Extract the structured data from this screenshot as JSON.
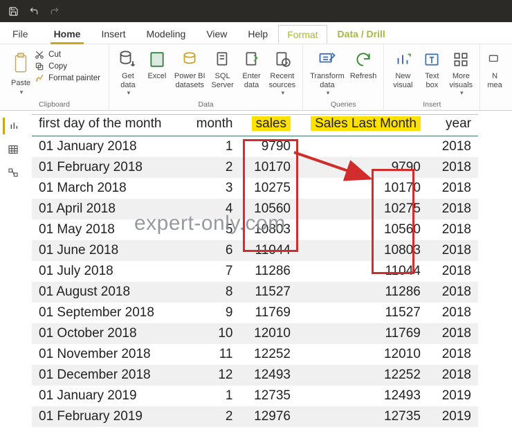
{
  "titlebar": {
    "icons": [
      "save-icon",
      "undo-icon",
      "redo-icon"
    ]
  },
  "tabs": {
    "file": "File",
    "items": [
      "Home",
      "Insert",
      "Modeling",
      "View",
      "Help",
      "Format",
      "Data / Drill"
    ],
    "active": "Home"
  },
  "ribbon": {
    "paste_label": "Paste",
    "cut_label": "Cut",
    "copy_label": "Copy",
    "format_painter_label": "Format painter",
    "clipboard_group": "Clipboard",
    "data_group": "Data",
    "queries_group": "Queries",
    "insert_group": "Insert",
    "buttons": {
      "get_data": "Get\ndata",
      "excel": "Excel",
      "pbi_datasets": "Power BI\ndatasets",
      "sql_server": "SQL\nServer",
      "enter_data": "Enter\ndata",
      "recent_sources": "Recent\nsources",
      "transform_data": "Transform\ndata",
      "refresh": "Refresh",
      "new_visual": "New\nvisual",
      "text_box": "Text\nbox",
      "more_visuals": "More\nvisuals",
      "new_measure": "N\nmea"
    }
  },
  "table": {
    "headers": {
      "first_day": "first day of the month",
      "month": "month",
      "sales": "sales",
      "sales_last_month": "Sales Last Month",
      "year": "year"
    },
    "rows": [
      {
        "date": "01 January 2018",
        "month": 1,
        "sales": 9790,
        "last": "",
        "year": 2018
      },
      {
        "date": "01 February 2018",
        "month": 2,
        "sales": 10170,
        "last": 9790,
        "year": 2018
      },
      {
        "date": "01 March 2018",
        "month": 3,
        "sales": 10275,
        "last": 10170,
        "year": 2018
      },
      {
        "date": "01 April 2018",
        "month": 4,
        "sales": 10560,
        "last": 10275,
        "year": 2018
      },
      {
        "date": "01 May 2018",
        "month": 5,
        "sales": 10803,
        "last": 10560,
        "year": 2018
      },
      {
        "date": "01 June 2018",
        "month": 6,
        "sales": 11044,
        "last": 10803,
        "year": 2018
      },
      {
        "date": "01 July 2018",
        "month": 7,
        "sales": 11286,
        "last": 11044,
        "year": 2018
      },
      {
        "date": "01 August 2018",
        "month": 8,
        "sales": 11527,
        "last": 11286,
        "year": 2018
      },
      {
        "date": "01 September 2018",
        "month": 9,
        "sales": 11769,
        "last": 11527,
        "year": 2018
      },
      {
        "date": "01 October 2018",
        "month": 10,
        "sales": 12010,
        "last": 11769,
        "year": 2018
      },
      {
        "date": "01 November 2018",
        "month": 11,
        "sales": 12252,
        "last": 12010,
        "year": 2018
      },
      {
        "date": "01 December 2018",
        "month": 12,
        "sales": 12493,
        "last": 12252,
        "year": 2018
      },
      {
        "date": "01 January 2019",
        "month": 1,
        "sales": 12735,
        "last": 12493,
        "year": 2019
      },
      {
        "date": "01 February 2019",
        "month": 2,
        "sales": 12976,
        "last": 12735,
        "year": 2019
      }
    ]
  },
  "watermark": "expert-only.com"
}
